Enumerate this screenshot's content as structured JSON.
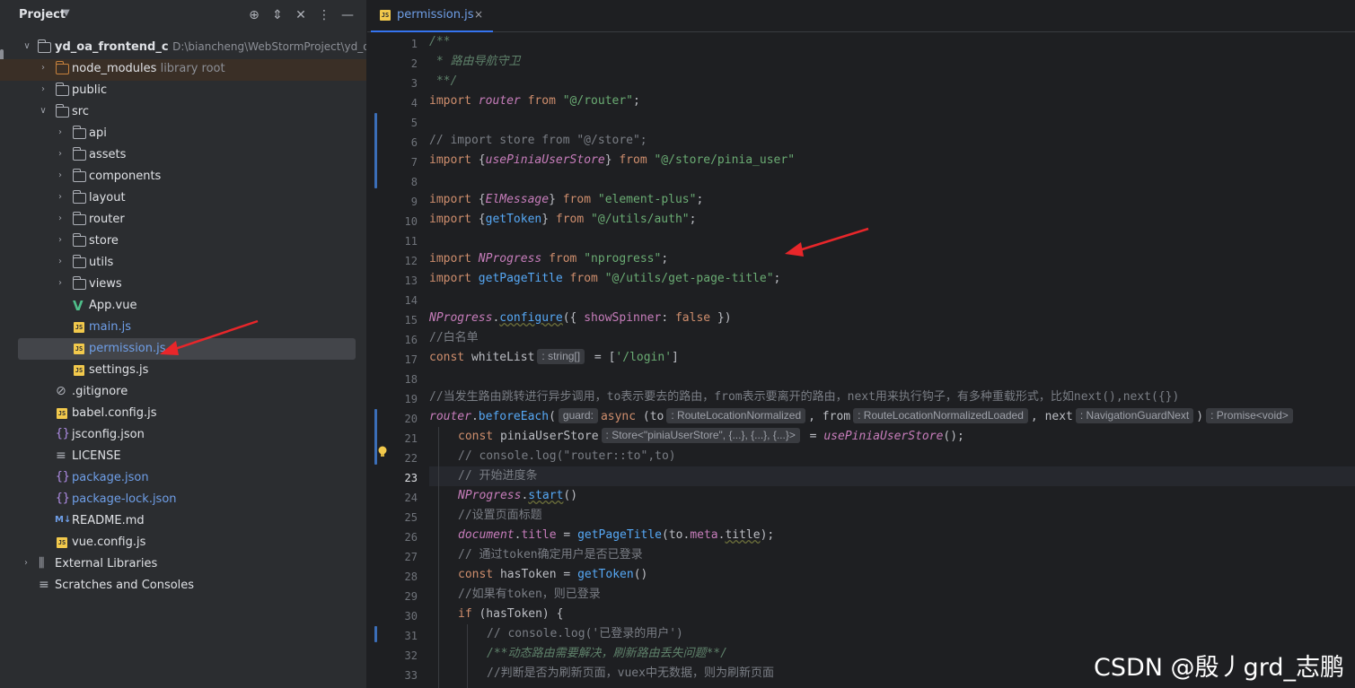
{
  "project_panel": {
    "title": "Project",
    "header_icons": [
      "crosshair-icon",
      "expand-collapse-icon",
      "collapse-all-icon",
      "more-icon",
      "minimize-icon"
    ],
    "tree": [
      {
        "label": "yd_oa_frontend_c",
        "hint": "D:\\biancheng\\WebStormProject\\yd_oa_fr",
        "icon": "folder-icon",
        "expanded": true
      },
      {
        "label": "node_modules",
        "hint": "library root",
        "icon": "folder-icon",
        "expanded": false
      },
      {
        "label": "public",
        "icon": "folder-icon",
        "expanded": false
      },
      {
        "label": "src",
        "icon": "folder-icon",
        "expanded": true
      },
      {
        "label": "api",
        "icon": "folder-icon",
        "expanded": false
      },
      {
        "label": "assets",
        "icon": "folder-icon",
        "expanded": false
      },
      {
        "label": "components",
        "icon": "folder-icon",
        "expanded": false
      },
      {
        "label": "layout",
        "icon": "folder-icon",
        "expanded": false
      },
      {
        "label": "router",
        "icon": "folder-icon",
        "expanded": false
      },
      {
        "label": "store",
        "icon": "folder-icon",
        "expanded": false
      },
      {
        "label": "utils",
        "icon": "folder-icon",
        "expanded": false
      },
      {
        "label": "views",
        "icon": "folder-icon",
        "expanded": false
      },
      {
        "label": "App.vue",
        "icon": "vue-file-icon"
      },
      {
        "label": "main.js",
        "icon": "js-file-icon"
      },
      {
        "label": "permission.js",
        "icon": "js-file-icon",
        "selected": true
      },
      {
        "label": "settings.js",
        "icon": "js-file-icon"
      },
      {
        "label": ".gitignore",
        "icon": "gitignore-icon"
      },
      {
        "label": "babel.config.js",
        "icon": "js-file-icon"
      },
      {
        "label": "jsconfig.json",
        "icon": "json-file-icon"
      },
      {
        "label": "LICENSE",
        "icon": "text-file-icon"
      },
      {
        "label": "package.json",
        "icon": "json-file-icon"
      },
      {
        "label": "package-lock.json",
        "icon": "json-file-icon"
      },
      {
        "label": "README.md",
        "icon": "markdown-file-icon"
      },
      {
        "label": "vue.config.js",
        "icon": "js-file-icon"
      },
      {
        "label": "External Libraries",
        "icon": "library-icon",
        "expanded": false
      },
      {
        "label": "Scratches and Consoles",
        "icon": "scratches-icon"
      }
    ]
  },
  "editor": {
    "tab": {
      "label": "permission.js",
      "close": "×"
    },
    "current_line": 23,
    "line_numbers": [
      "1",
      "2",
      "3",
      "4",
      "5",
      "6",
      "7",
      "8",
      "9",
      "10",
      "11",
      "12",
      "13",
      "14",
      "15",
      "16",
      "17",
      "18",
      "19",
      "20",
      "21",
      "22",
      "23",
      "24",
      "25",
      "26",
      "27",
      "28",
      "29",
      "30",
      "31",
      "32",
      "33"
    ],
    "inlay_hints": {
      "string_array": ": string[]",
      "guard": "guard:",
      "route_location": ": RouteLocationNormalized",
      "route_loaded": ": RouteLocationNormalizedLoaded",
      "nav_guard": ": NavigationGuardNext",
      "promise": ": Promise<void>",
      "store": ": Store<\"piniaUserStore\", {...}, {...}, {...}>"
    },
    "code": {
      "l1": "/**",
      "l2": " * 路由导航守卫",
      "l3": " **/",
      "l4": [
        "import",
        " router",
        " from",
        " \"@/router\"",
        ";"
      ],
      "l6": "// import store from \"@/store\";",
      "l7": [
        "import",
        " {",
        "usePiniaUserStore",
        "}",
        " from",
        " \"@/store/pinia_user\""
      ],
      "l9": [
        "import",
        " {",
        "ElMessage",
        "}",
        " from",
        " \"element-plus\"",
        ";"
      ],
      "l10": [
        "import",
        " {",
        "getToken",
        "}",
        " from",
        " \"@/utils/auth\"",
        ";"
      ],
      "l12": [
        "import",
        " NProgress",
        " from",
        " \"nprogress\"",
        ";"
      ],
      "l13": [
        "import",
        " getPageTitle",
        " from",
        " \"@/utils/get-page-title\"",
        ";"
      ],
      "l15": [
        "NProgress",
        ".",
        "configure",
        "({ ",
        "showSpinner",
        ": ",
        "false",
        " })"
      ],
      "l16": "//白名单",
      "l17": [
        "const",
        " whiteList",
        " = [",
        "'/login'",
        "]"
      ],
      "l19": "//当发生路由跳转进行异步调用，to表示要去的路由，from表示要离开的路由，next用来执行钩子，有多种重载形式，比如next(),next({})",
      "l20": [
        "router",
        ".",
        "beforeEach",
        "(",
        "async",
        " (to",
        ", ",
        "from",
        ", ",
        "next",
        ")"
      ],
      "l21": [
        "const",
        " piniaUserStore",
        " = ",
        "usePiniaUserStore",
        "();"
      ],
      "l22": "// console.log(\"router::to\",to)",
      "l23": "// 开始进度条",
      "l24": [
        "NProgress",
        ".",
        "start",
        "()"
      ],
      "l25": "//设置页面标题",
      "l26": [
        "document",
        ".",
        "title",
        " = ",
        "getPageTitle",
        "(to.",
        "meta",
        ".",
        "title",
        ");"
      ],
      "l27": "// 通过token确定用户是否已登录",
      "l28": [
        "const",
        " hasToken",
        " = ",
        "getToken",
        "()"
      ],
      "l29": "//如果有token，则已登录",
      "l30": [
        "if",
        " (hasToken) {"
      ],
      "l31": "// console.log('已登录的用户')",
      "l32": "/**动态路由需要解决，刷新路由丢失问题**/",
      "l33": "//判断是否为刷新页面，vuex中无数据，则为刷新页面"
    }
  },
  "watermark": "CSDN @殷丿grd_志鹏",
  "colors": {
    "annotation_arrow": "#e8262a",
    "accent": "#3574f0"
  }
}
